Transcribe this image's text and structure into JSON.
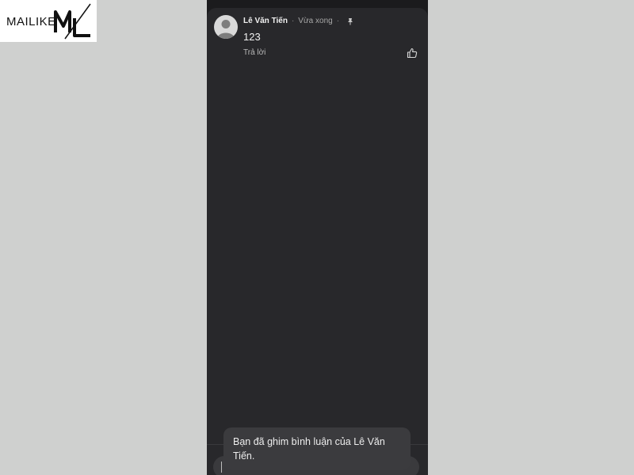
{
  "watermark": {
    "text": "MAILIKE",
    "mark": "ML"
  },
  "comment": {
    "author": "Lê Văn Tiến",
    "separator": "·",
    "time": "Vừa xong",
    "pin_separator": "·",
    "text": "123",
    "reply_label": "Trả lời",
    "icons": {
      "avatar": "default-avatar-icon",
      "pin": "pin-icon",
      "like": "thumbs-up-icon"
    }
  },
  "toast": {
    "message": "Bạn đã ghim bình luận của Lê Văn Tiến."
  },
  "colors": {
    "background": "#cfd0cf",
    "sheet": "#28282b",
    "toast": "#3b3b3e",
    "text": "#f2f2f2"
  }
}
